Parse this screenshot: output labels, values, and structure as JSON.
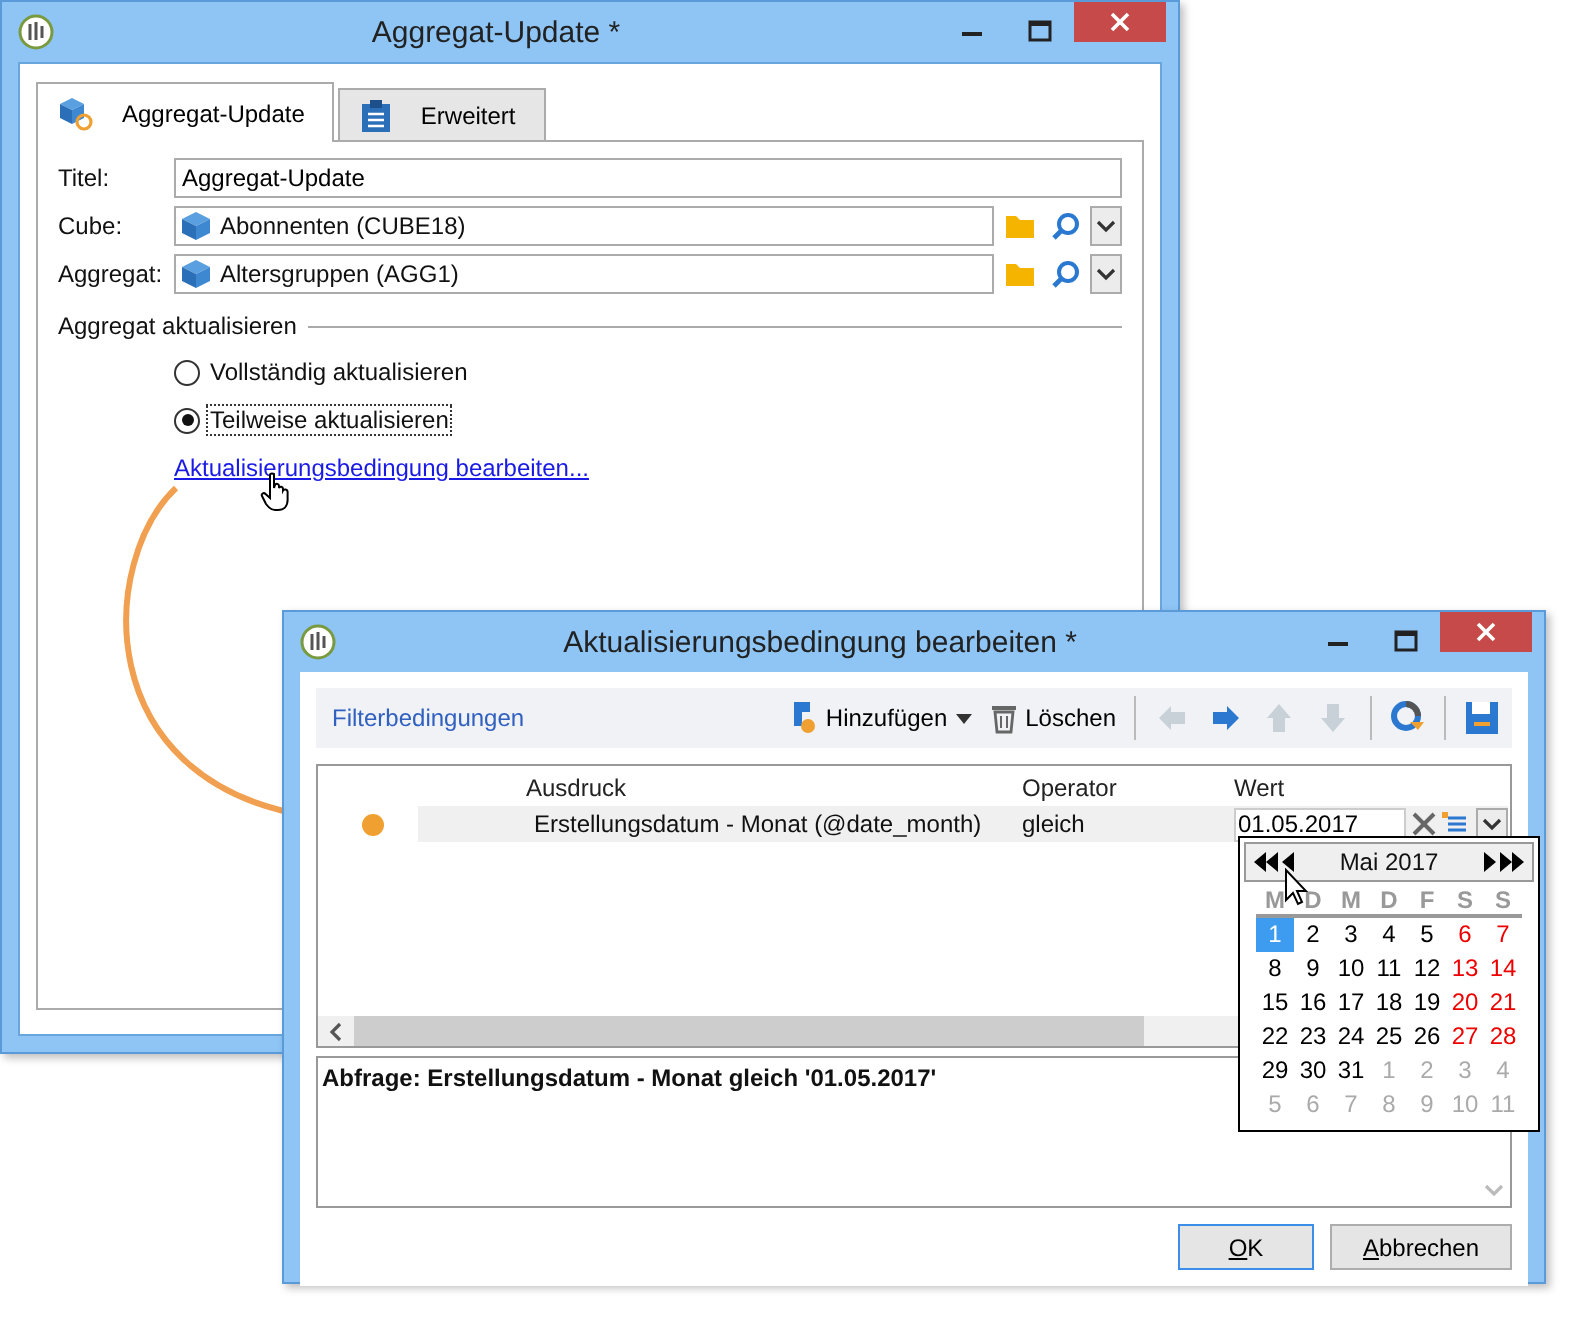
{
  "main_window": {
    "title": "Aggregat-Update *",
    "tabs": [
      {
        "label": "Aggregat-Update",
        "selected": true,
        "kind": "cube"
      },
      {
        "label": "Erweitert",
        "selected": false,
        "kind": "clipboard"
      }
    ],
    "fields": [
      {
        "label": "Titel:",
        "value": "Aggregat-Update",
        "kind": "text"
      },
      {
        "label": "Cube:",
        "value": "Abonnenten (CUBE18)",
        "kind": "link"
      },
      {
        "label": "Aggregat:",
        "value": "Altersgruppen (AGG1)",
        "kind": "link"
      }
    ],
    "section": "Aggregat aktualisieren",
    "radios": [
      {
        "label": "Vollständig aktualisieren",
        "selected": false
      },
      {
        "label": "Teilweise aktualisieren",
        "selected": true
      }
    ],
    "link": "Aktualisierungsbedingung bearbeiten..."
  },
  "dialog": {
    "title": "Aktualisierungsbedingung bearbeiten *",
    "toolbar": {
      "title": "Filterbedingungen",
      "add": "Hinzufügen",
      "delete": "Löschen",
      "nav_buttons": [
        {
          "kind": "left",
          "disabled": true
        },
        {
          "kind": "right",
          "disabled": false
        },
        {
          "kind": "up",
          "disabled": true
        },
        {
          "kind": "down",
          "disabled": true
        }
      ]
    },
    "columns": [
      "Ausdruck",
      "Operator",
      "Wert"
    ],
    "rows": [
      {
        "expression": "Erstellungsdatum - Monat (@date_month)",
        "operator": "gleich",
        "value": "01.05.2017"
      }
    ],
    "calendar": {
      "month": "Mai 2017",
      "weekdays": [
        "M",
        "D",
        "M",
        "D",
        "F",
        "S",
        "S"
      ],
      "weeks": [
        [
          {
            "day": "1",
            "kind": "day",
            "selected": true
          },
          {
            "day": "2",
            "kind": "day",
            "selected": false
          },
          {
            "day": "3",
            "kind": "day",
            "selected": false
          },
          {
            "day": "4",
            "kind": "day",
            "selected": false
          },
          {
            "day": "5",
            "kind": "day",
            "selected": false
          },
          {
            "day": "6",
            "kind": "weekend",
            "selected": false
          },
          {
            "day": "7",
            "kind": "weekend",
            "selected": false
          }
        ],
        [
          {
            "day": "8",
            "kind": "day",
            "selected": false
          },
          {
            "day": "9",
            "kind": "day",
            "selected": false
          },
          {
            "day": "10",
            "kind": "day",
            "selected": false
          },
          {
            "day": "11",
            "kind": "day",
            "selected": false
          },
          {
            "day": "12",
            "kind": "day",
            "selected": false
          },
          {
            "day": "13",
            "kind": "weekend",
            "selected": false
          },
          {
            "day": "14",
            "kind": "weekend",
            "selected": false
          }
        ],
        [
          {
            "day": "15",
            "kind": "day",
            "selected": false
          },
          {
            "day": "16",
            "kind": "day",
            "selected": false
          },
          {
            "day": "17",
            "kind": "day",
            "selected": false
          },
          {
            "day": "18",
            "kind": "day",
            "selected": false
          },
          {
            "day": "19",
            "kind": "day",
            "selected": false
          },
          {
            "day": "20",
            "kind": "weekend",
            "selected": false
          },
          {
            "day": "21",
            "kind": "weekend",
            "selected": false
          }
        ],
        [
          {
            "day": "22",
            "kind": "day",
            "selected": false
          },
          {
            "day": "23",
            "kind": "day",
            "selected": false
          },
          {
            "day": "24",
            "kind": "day",
            "selected": false
          },
          {
            "day": "25",
            "kind": "day",
            "selected": false
          },
          {
            "day": "26",
            "kind": "day",
            "selected": false
          },
          {
            "day": "27",
            "kind": "weekend",
            "selected": false
          },
          {
            "day": "28",
            "kind": "weekend",
            "selected": false
          }
        ],
        [
          {
            "day": "29",
            "kind": "day",
            "selected": false
          },
          {
            "day": "30",
            "kind": "day",
            "selected": false
          },
          {
            "day": "31",
            "kind": "day",
            "selected": false
          },
          {
            "day": "1",
            "kind": "other",
            "selected": false
          },
          {
            "day": "2",
            "kind": "other",
            "selected": false
          },
          {
            "day": "3",
            "kind": "other",
            "selected": false
          },
          {
            "day": "4",
            "kind": "other",
            "selected": false
          }
        ],
        [
          {
            "day": "5",
            "kind": "other",
            "selected": false
          },
          {
            "day": "6",
            "kind": "other",
            "selected": false
          },
          {
            "day": "7",
            "kind": "other",
            "selected": false
          },
          {
            "day": "8",
            "kind": "other",
            "selected": false
          },
          {
            "day": "9",
            "kind": "other",
            "selected": false
          },
          {
            "day": "10",
            "kind": "other",
            "selected": false
          },
          {
            "day": "11",
            "kind": "other",
            "selected": false
          }
        ]
      ]
    },
    "query": "Abfrage: Erstellungsdatum - Monat gleich '01.05.2017'",
    "buttons": [
      "OK",
      "Abbrechen"
    ]
  }
}
